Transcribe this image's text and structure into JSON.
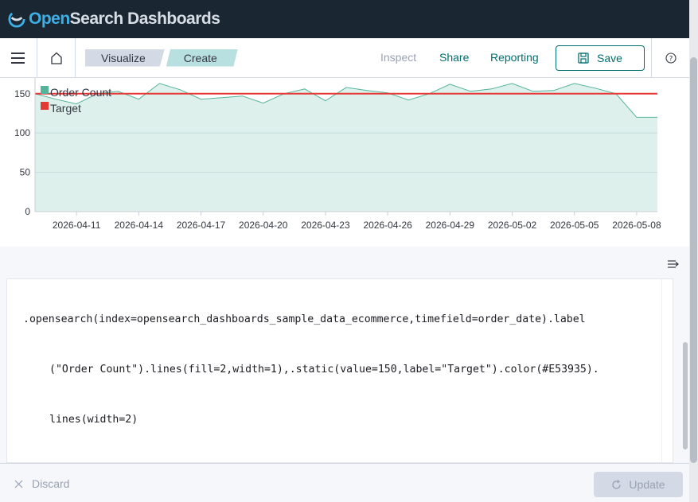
{
  "header": {
    "logo_part1": "Open",
    "logo_part2": "Search Dashboards"
  },
  "appbar": {
    "breadcrumbs": [
      "Visualize",
      "Create"
    ],
    "inspect": "Inspect",
    "share": "Share",
    "reporting": "Reporting",
    "save": "Save"
  },
  "chart_data": {
    "type": "area",
    "legend": [
      "Order Count",
      "Target"
    ],
    "colors": {
      "order_count": "#54b399",
      "target": "#e53935"
    },
    "ylim": [
      0,
      170
    ],
    "yticks": [
      "0",
      "50",
      "100",
      "150"
    ],
    "xticks": [
      "2026-04-11",
      "2026-04-14",
      "2026-04-17",
      "2026-04-20",
      "2026-04-23",
      "2026-04-26",
      "2026-04-29",
      "2026-05-02",
      "2026-05-05",
      "2026-05-08"
    ],
    "x": [
      "2026-04-09",
      "2026-04-10",
      "2026-04-11",
      "2026-04-12",
      "2026-04-13",
      "2026-04-14",
      "2026-04-15",
      "2026-04-16",
      "2026-04-17",
      "2026-04-18",
      "2026-04-19",
      "2026-04-20",
      "2026-04-21",
      "2026-04-22",
      "2026-04-23",
      "2026-04-24",
      "2026-04-25",
      "2026-04-26",
      "2026-04-27",
      "2026-04-28",
      "2026-04-29",
      "2026-04-30",
      "2026-05-01",
      "2026-05-02",
      "2026-05-03",
      "2026-05-04",
      "2026-05-05",
      "2026-05-06",
      "2026-05-07",
      "2026-05-08",
      "2026-05-09"
    ],
    "series": [
      {
        "name": "Order Count",
        "values": [
          150,
          143,
          137,
          150,
          153,
          143,
          163,
          155,
          143,
          145,
          147,
          138,
          150,
          156,
          141,
          158,
          154,
          151,
          142,
          150,
          162,
          153,
          156,
          163,
          153,
          154,
          163,
          157,
          150,
          120,
          120
        ]
      },
      {
        "name": "Target",
        "values": [
          150,
          150
        ]
      }
    ]
  },
  "editor": {
    "line1": ".opensearch(index=opensearch_dashboards_sample_data_ecommerce,timefield=order_date).label",
    "line2": "(\"Order Count\").lines(fill=2,width=1),.static(value=150,label=\"Target\").color(#E53935).",
    "line3": "lines(width=2)"
  },
  "footer": {
    "discard": "Discard",
    "update": "Update"
  }
}
